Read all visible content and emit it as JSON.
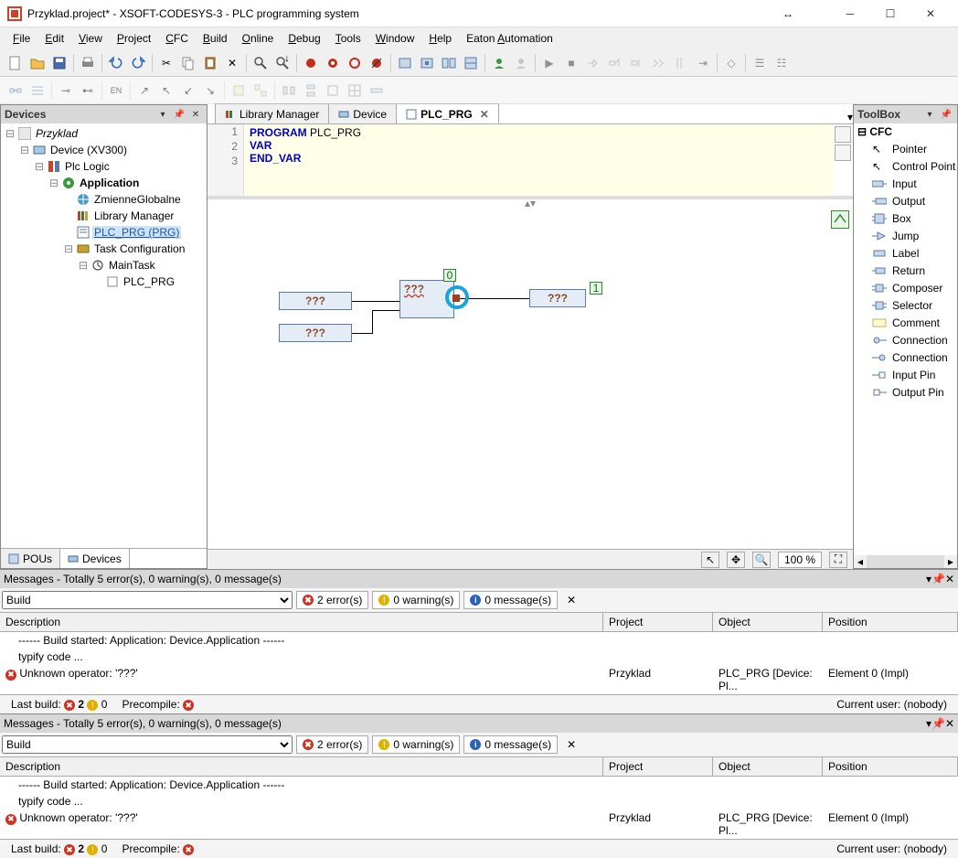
{
  "titlebar": {
    "title": "Przyklad.project* - XSOFT-CODESYS-3 - PLC programming system"
  },
  "menu": [
    "File",
    "Edit",
    "View",
    "Project",
    "CFC",
    "Build",
    "Online",
    "Debug",
    "Tools",
    "Window",
    "Help",
    "Eaton Automation"
  ],
  "devices": {
    "title": "Devices",
    "tree": {
      "root": "Przyklad",
      "device": "Device (XV300)",
      "plc": "Plc Logic",
      "app": "Application",
      "items": [
        "ZmienneGlobalne",
        "Library Manager",
        "PLC_PRG (PRG)",
        "Task Configuration"
      ],
      "maintask": "MainTask",
      "leaf": "PLC_PRG"
    },
    "tabs": {
      "pous": "POUs",
      "devices": "Devices"
    }
  },
  "editor": {
    "tabs": [
      {
        "label": "Library Manager",
        "active": false,
        "close": false
      },
      {
        "label": "Device",
        "active": false,
        "close": false
      },
      {
        "label": "PLC_PRG",
        "active": true,
        "close": true
      }
    ],
    "lines": [
      "1",
      "2",
      "3"
    ],
    "code": {
      "l1a": "PROGRAM",
      "l1b": "PLC_PRG",
      "l2": "VAR",
      "l3": "END_VAR"
    }
  },
  "cfc": {
    "in1": "???",
    "in2": "???",
    "box": "???",
    "out": "???",
    "badge0": "0",
    "badge1": "1",
    "zoom": "100 %"
  },
  "toolbox": {
    "title": "ToolBox",
    "cat": "CFC",
    "items": [
      "Pointer",
      "Control Point",
      "Input",
      "Output",
      "Box",
      "Jump",
      "Label",
      "Return",
      "Composer",
      "Selector",
      "Comment",
      "Connection",
      "Connection",
      "Input Pin",
      "Output Pin"
    ]
  },
  "messages": {
    "header": "Messages - Totally 5 error(s), 0 warning(s), 0 message(s)",
    "dropdown": "Build",
    "chips": {
      "err": "2 error(s)",
      "wrn": "0 warning(s)",
      "inf": "0 message(s)"
    },
    "cols": {
      "desc": "Description",
      "proj": "Project",
      "obj": "Object",
      "pos": "Position"
    },
    "rows": [
      {
        "desc": "------ Build started: Application: Device.Application ------",
        "proj": "",
        "obj": "",
        "pos": ""
      },
      {
        "desc": "typify code ...",
        "proj": "",
        "obj": "",
        "pos": ""
      },
      {
        "desc": "Unknown operator: '???'",
        "proj": "Przyklad",
        "obj": "PLC_PRG [Device: Pl...",
        "pos": "Element 0 (Impl)",
        "err": true
      }
    ],
    "status": {
      "lastbuild": "Last build:",
      "b1": "2",
      "b2": "0",
      "precompile": "Precompile:",
      "user": "Current user: (nobody)"
    }
  }
}
